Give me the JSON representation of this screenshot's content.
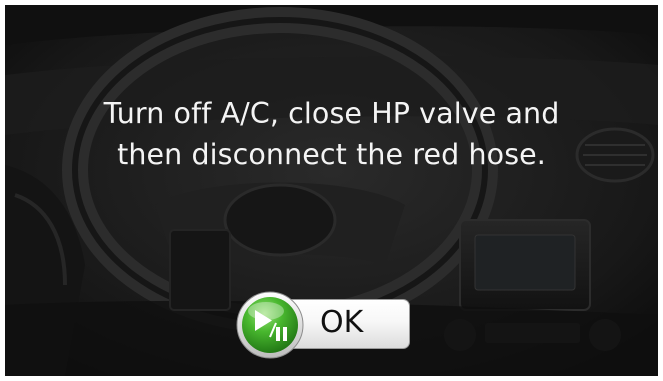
{
  "dialog": {
    "message_line1": "Turn off A/C, close HP valve and",
    "message_line2": "then disconnect the red hose.",
    "ok_label": "OK",
    "ok_icon": "play-pause-icon"
  },
  "colors": {
    "text": "#f4f4f4",
    "icon_green": "#3fb12a",
    "button_face": "#f2f2f2"
  }
}
